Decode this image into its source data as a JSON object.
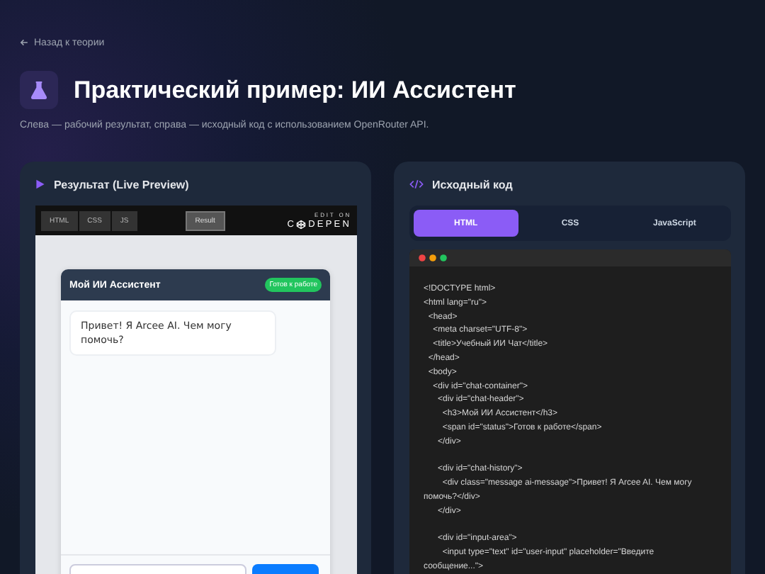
{
  "back_link": {
    "label": "Назад к теории"
  },
  "header": {
    "title": "Практический пример: ИИ Ассистент",
    "subtitle": "Слева — рабочий результат, справа — исходный код с использованием OpenRouter API."
  },
  "preview": {
    "title": "Результат (Live Preview)",
    "embed": {
      "tabs": [
        {
          "label": "HTML",
          "selected": false
        },
        {
          "label": "CSS",
          "selected": false
        },
        {
          "label": "JS",
          "selected": false
        }
      ],
      "result_tab": {
        "label": "Result",
        "selected": true
      },
      "edit_label": "EDIT ON",
      "logo_parts": [
        "C",
        "DEPEN"
      ],
      "chat": {
        "title": "Мой ИИ Ассистент",
        "status": "Готов к работе",
        "messages": [
          {
            "text": "Привет! Я Arcee AI. Чем могу помочь?"
          }
        ]
      }
    }
  },
  "source": {
    "title": "Исходный код",
    "tabs": [
      {
        "label": "HTML",
        "selected": true
      },
      {
        "label": "CSS",
        "selected": false
      },
      {
        "label": "JavaScript",
        "selected": false
      }
    ],
    "code_blocks": [
      [
        "<!DOCTYPE html>",
        "<html lang=\"ru\">",
        "  <head>",
        "    <meta charset=\"UTF-8\">",
        "    <title>Учебный ИИ Чат</title>",
        "  </head>",
        "  <body>",
        "    <div id=\"chat-container\">",
        "      <div id=\"chat-header\">",
        "        <h3>Мой ИИ Ассистент</h3>",
        "        <span id=\"status\">Готов к работе</span>",
        "      </div>"
      ],
      [
        "      <div id=\"chat-history\">",
        "        <div class=\"message ai-message\">Привет! Я Arcee AI. Чем могу помочь?</div>",
        "      </div>"
      ],
      [
        "      <div id=\"input-area\">",
        "        <input type=\"text\" id=\"user-input\" placeholder=\"Введите сообщение...\">"
      ]
    ]
  }
}
